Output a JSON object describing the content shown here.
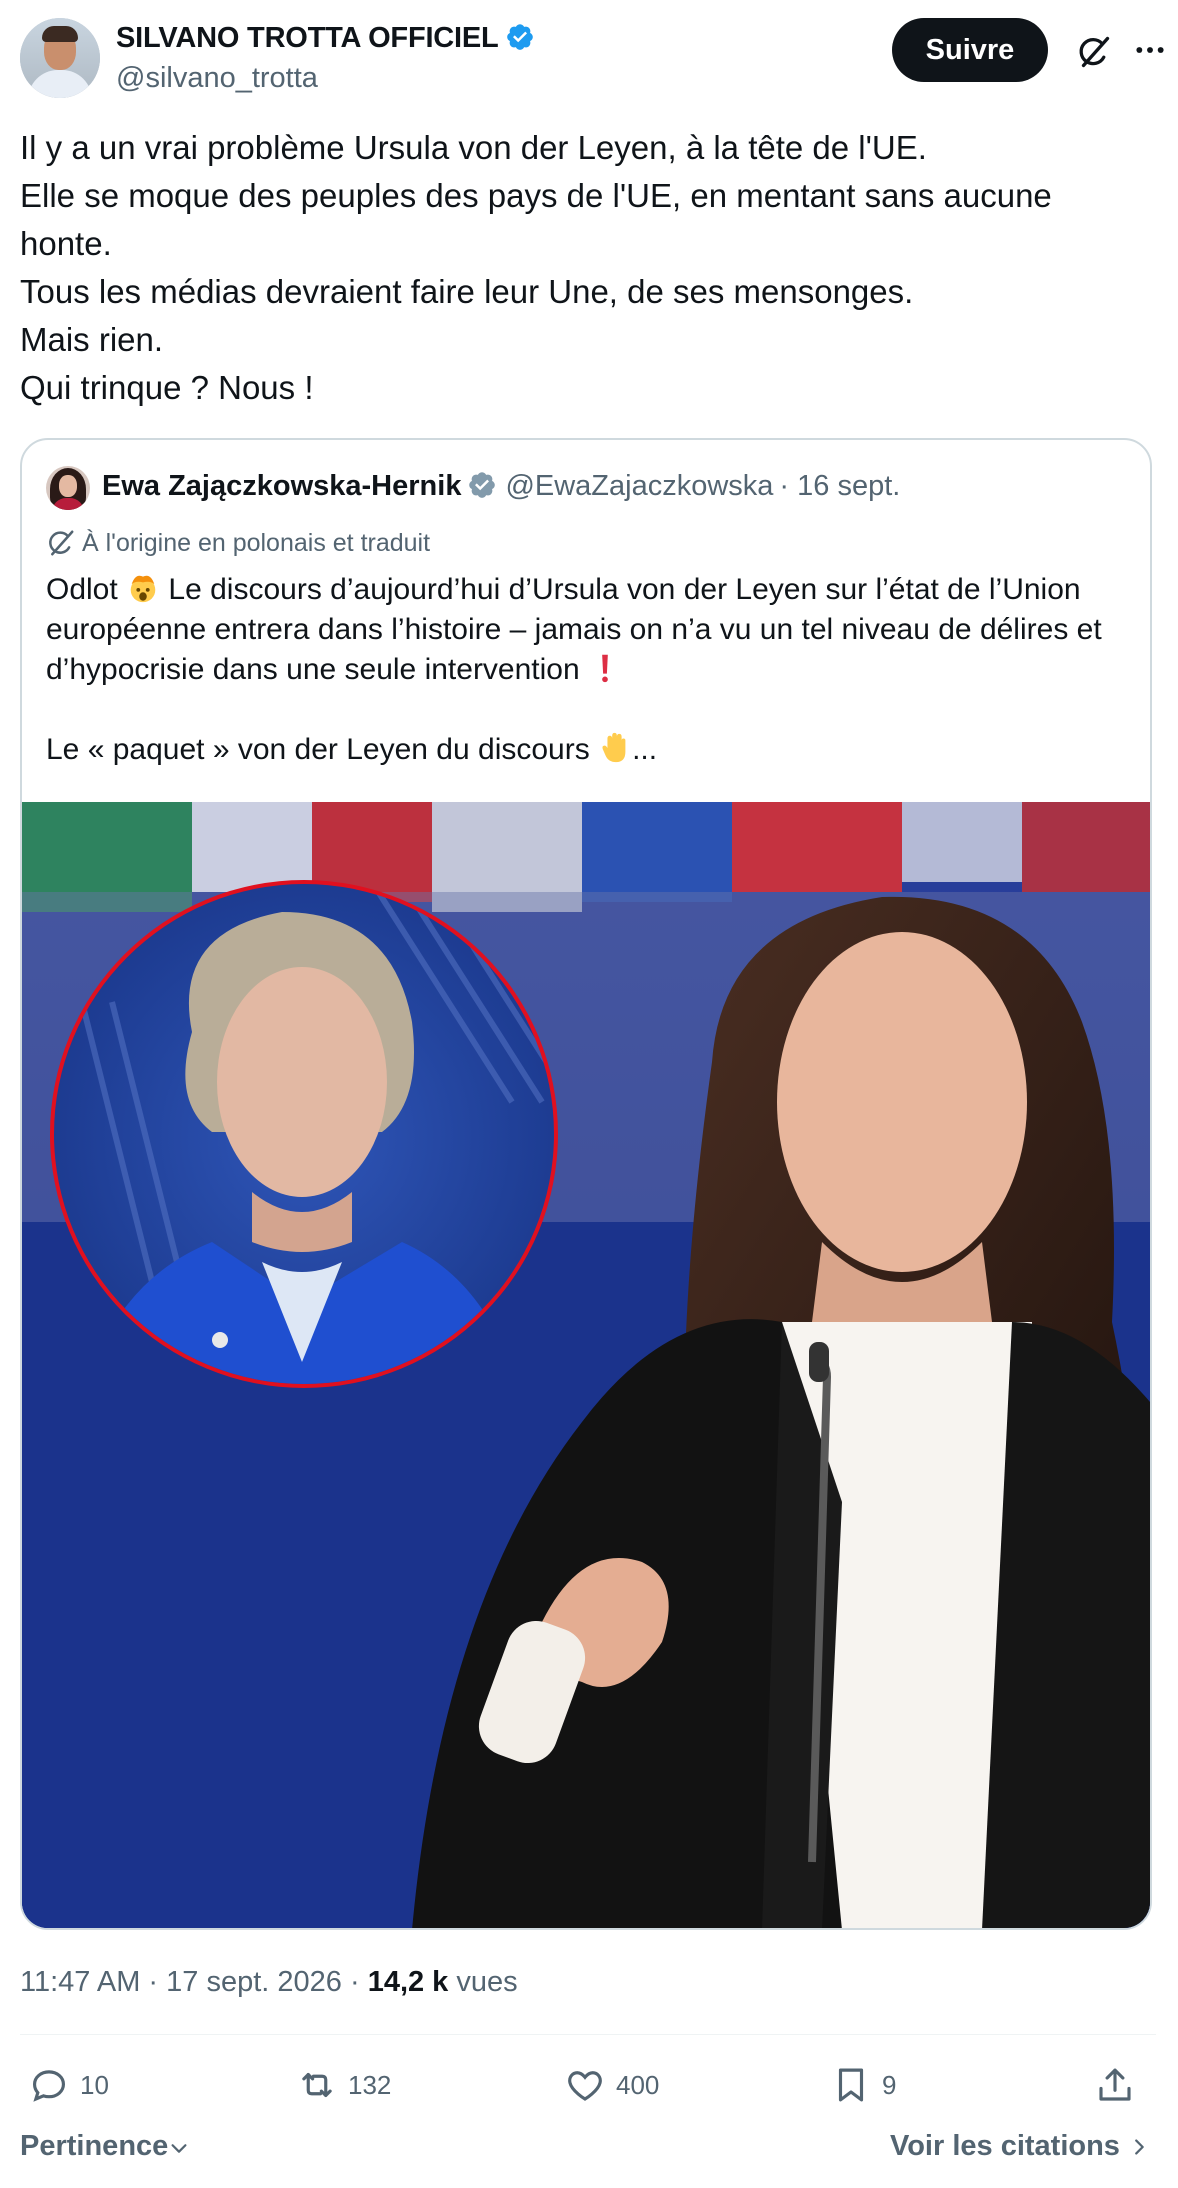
{
  "post": {
    "author": {
      "name": "SILVANO TROTTA OFFICIEL",
      "handle": "@silvano_trotta",
      "verified": true
    },
    "follow_label": "Suivre",
    "text_lines": [
      "Il y a un vrai problème Ursula von der Leyen, à la tête de l'UE.",
      "Elle se moque des peuples des pays de l'UE, en mentant sans aucune",
      "honte.",
      "Tous les médias devraient faire leur Une, de ses mensonges.",
      "Mais rien.",
      "Qui trinque ? Nous !"
    ],
    "timestamp": {
      "time_date": "11:47 AM · 17 sept. 2026 ·",
      "views_count": "14,2 k",
      "views_label": "vues"
    },
    "stats": {
      "replies": "10",
      "reposts": "132",
      "likes": "400",
      "bookmarks": "9"
    },
    "sort_label": "Pertinence",
    "view_quotes_label": "Voir les citations"
  },
  "quote": {
    "author_name": "Ewa Zajączkowska-Hernik",
    "handle": "@EwaZajaczkowska",
    "date": "· 16 sept.",
    "translation_note": "À l'origine en polonais et traduit",
    "line1_a": "Odlot",
    "line1_b": "Le discours d’aujourd’hui d’Ursula von der Leyen sur l’état de l’Union",
    "line2": "européenne entrera dans l’histoire – jamais on n’a vu un tel niveau de délires et",
    "line3": "d’hypocrisie dans une seule intervention",
    "line4_a": "Le « paquet » von der Leyen du discours",
    "line4_b": "..."
  },
  "colors": {
    "text_primary": "#0f1419",
    "text_secondary": "#536471",
    "verified_blue": "#1d9bf0",
    "verified_gray": "#829aab",
    "border": "#cfd9de",
    "red_accent": "#e0101f"
  },
  "icons": [
    "verified-badge-icon",
    "grok-icon",
    "more-icon",
    "translate-icon",
    "reply-icon",
    "repost-icon",
    "like-icon",
    "bookmark-icon",
    "share-icon",
    "chevron-down-icon",
    "chevron-right-icon"
  ]
}
